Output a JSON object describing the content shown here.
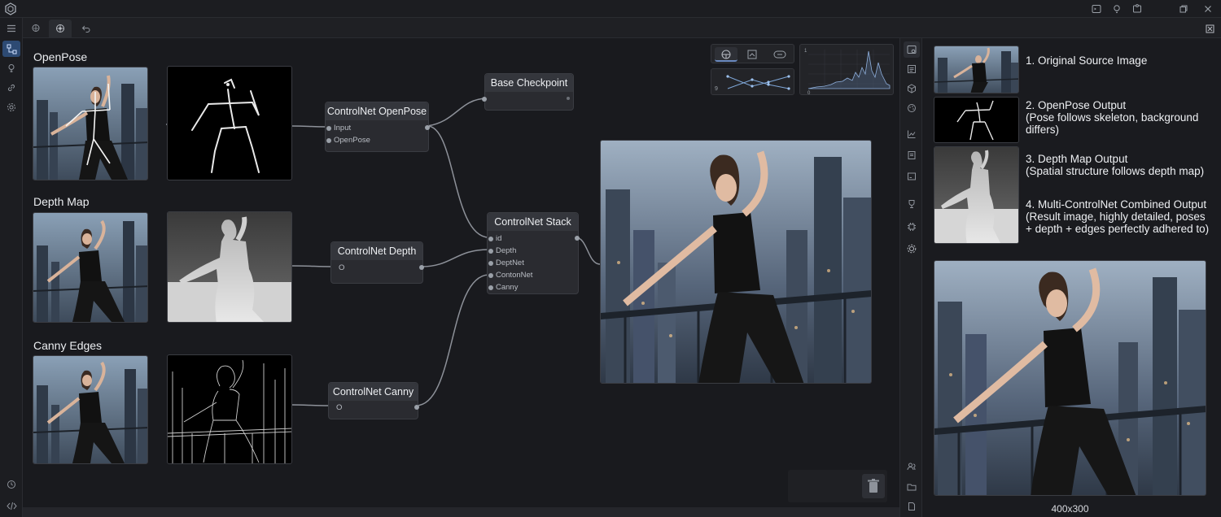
{
  "window": {
    "logo_icon": "hexagon-logo-icon",
    "controls": [
      "terminal-icon",
      "bulb-icon",
      "puzzle-icon",
      "restore-icon",
      "close-icon"
    ]
  },
  "tabs": [
    {
      "icon": "brain-icon",
      "active": false
    },
    {
      "icon": "network-icon",
      "active": true
    },
    {
      "icon": "undo-icon",
      "active": false
    }
  ],
  "canvas": {
    "sections": {
      "openpose": "OpenPose",
      "depth": "Depth Map",
      "canny": "Canny Edges"
    },
    "nodes": {
      "base_checkpoint": {
        "title": "Base Checkpoint"
      },
      "openpose": {
        "title": "ControlNet OpenPose",
        "ports": [
          "Input",
          "OpenPose"
        ]
      },
      "depth": {
        "title": "ControlNet Depth",
        "ports": [
          "O"
        ]
      },
      "canny": {
        "title": "ControlNet Canny",
        "ports": [
          "O"
        ]
      },
      "stack": {
        "title": "ControlNet Stack",
        "ports": [
          "id",
          "Depth",
          "DeptNet",
          "ContonNet",
          "Canny"
        ]
      }
    },
    "mini_panel": {
      "tools": [
        "steering-icon",
        "image-icon",
        "link-icon"
      ],
      "chart_tick": "1",
      "chart_x0": "0",
      "line_label": "9"
    }
  },
  "right_panel": {
    "items": [
      {
        "lines": [
          "1. Original Source Image"
        ]
      },
      {
        "lines": [
          "2. OpenPose Output",
          "(Pose follows skeleton, background",
          "differs)"
        ]
      },
      {
        "lines": [
          "3. Depth Map Output",
          "(Spatial structure follows depth map)"
        ]
      },
      {
        "lines": [
          "4. Multi-ControlNet Combined Output",
          "(Result image, highly detailed, poses",
          "+ depth + edges perfectly adhered to)"
        ]
      }
    ],
    "footer": "400x300"
  },
  "colors": {
    "accent": "#2d4a73",
    "canvas": "#191a1e",
    "node": "#2a2b30",
    "wire": "#8d9199"
  }
}
